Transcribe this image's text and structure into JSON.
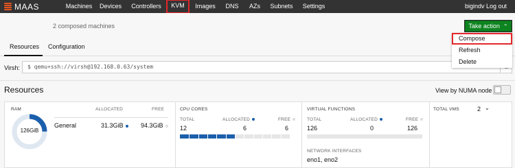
{
  "nav": {
    "logo": "MAAS",
    "items": [
      "Machines",
      "Devices",
      "Controllers",
      "KVM",
      "Images",
      "DNS",
      "AZs",
      "Subnets",
      "Settings"
    ],
    "user": "bigindv",
    "logout": "Log out"
  },
  "header": {
    "composed_count": "2 composed machines",
    "take_action": "Take action"
  },
  "dropdown": {
    "items": [
      "Compose",
      "Refresh",
      "Delete"
    ]
  },
  "tabs": [
    "Resources",
    "Configuration"
  ],
  "virsh": {
    "label": "Virsh:",
    "address": "qemu+ssh://virsh@192.168.0.63/system",
    "prompt": "$"
  },
  "resources": {
    "title": "Resources",
    "numa_toggle_label": "View by NUMA node",
    "numa_enabled": false
  },
  "ram": {
    "label": "RAM",
    "allocated_header": "ALLOCATED",
    "free_header": "FREE",
    "row_label": "General",
    "allocated": "31.3GiB",
    "free": "94.3GiB",
    "total": "126GiB",
    "allocated_fraction": 0.248
  },
  "cpu": {
    "label": "CPU CORES",
    "total_header": "TOTAL",
    "allocated_header": "ALLOCATED",
    "free_header": "FREE",
    "total": "12",
    "allocated": "6",
    "free": "6",
    "allocated_fraction": 0.5
  },
  "vf": {
    "label": "VIRTUAL FUNCTIONS",
    "total_header": "TOTAL",
    "allocated_header": "ALLOCATED",
    "free_header": "FREE",
    "total": "126",
    "allocated": "0",
    "free": "126",
    "interfaces_header": "NETWORK INTERFACES",
    "interfaces": "eno1, eno2"
  },
  "vms": {
    "label": "TOTAL VMS",
    "count": "2"
  },
  "colors": {
    "navbar": "#333333",
    "accent": "#e95420",
    "highlight": "#e3262a",
    "action_green": "#0e8420",
    "allocated_blue": "#1b5fac"
  }
}
